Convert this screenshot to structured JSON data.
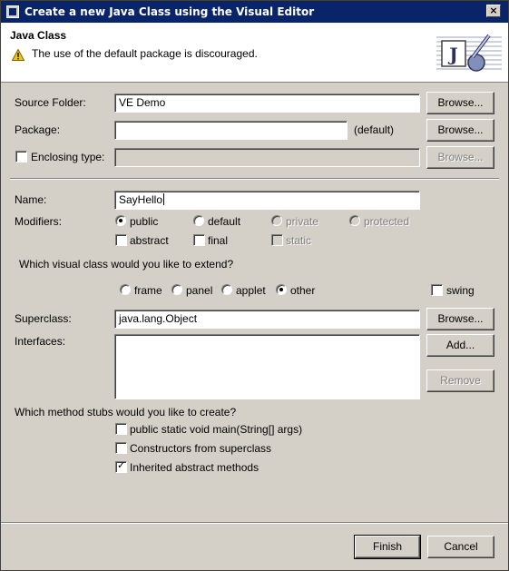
{
  "window": {
    "title": "Create a new Java Class using the Visual Editor",
    "close_label": "×"
  },
  "banner": {
    "title": "Java Class",
    "message": "The use of the default package is discouraged.",
    "icon": "java-class-wizard-icon",
    "icon_letter": "J"
  },
  "source_folder": {
    "label": "Source Folder:",
    "value": "VE Demo",
    "browse": "Browse..."
  },
  "package": {
    "label": "Package:",
    "value": "",
    "hint": "(default)",
    "browse": "Browse..."
  },
  "enclosing_type": {
    "label": "Enclosing type:",
    "checked": false,
    "value": "",
    "browse": "Browse..."
  },
  "name": {
    "label": "Name:",
    "value": "SayHello"
  },
  "modifiers": {
    "label": "Modifiers:",
    "access": [
      {
        "label": "public",
        "selected": true,
        "enabled": true
      },
      {
        "label": "default",
        "selected": false,
        "enabled": true
      },
      {
        "label": "private",
        "selected": false,
        "enabled": false
      },
      {
        "label": "protected",
        "selected": false,
        "enabled": false
      }
    ],
    "flags": [
      {
        "label": "abstract",
        "checked": false,
        "enabled": true
      },
      {
        "label": "final",
        "checked": false,
        "enabled": true
      },
      {
        "label": "static",
        "checked": false,
        "enabled": false
      }
    ]
  },
  "visual_class": {
    "question": "Which visual class would you like to extend?",
    "options": [
      {
        "label": "frame",
        "selected": false
      },
      {
        "label": "panel",
        "selected": false
      },
      {
        "label": "applet",
        "selected": false
      },
      {
        "label": "other",
        "selected": true
      }
    ],
    "swing": {
      "label": "swing",
      "checked": false
    }
  },
  "superclass": {
    "label": "Superclass:",
    "value": "java.lang.Object",
    "browse": "Browse..."
  },
  "interfaces": {
    "label": "Interfaces:",
    "add": "Add...",
    "remove": "Remove"
  },
  "stubs": {
    "question": "Which method stubs would you like to create?",
    "items": [
      {
        "label": "public static void main(String[] args)",
        "checked": false
      },
      {
        "label": "Constructors from superclass",
        "checked": false
      },
      {
        "label": "Inherited abstract methods",
        "checked": true
      }
    ]
  },
  "footer": {
    "finish": "Finish",
    "cancel": "Cancel"
  }
}
